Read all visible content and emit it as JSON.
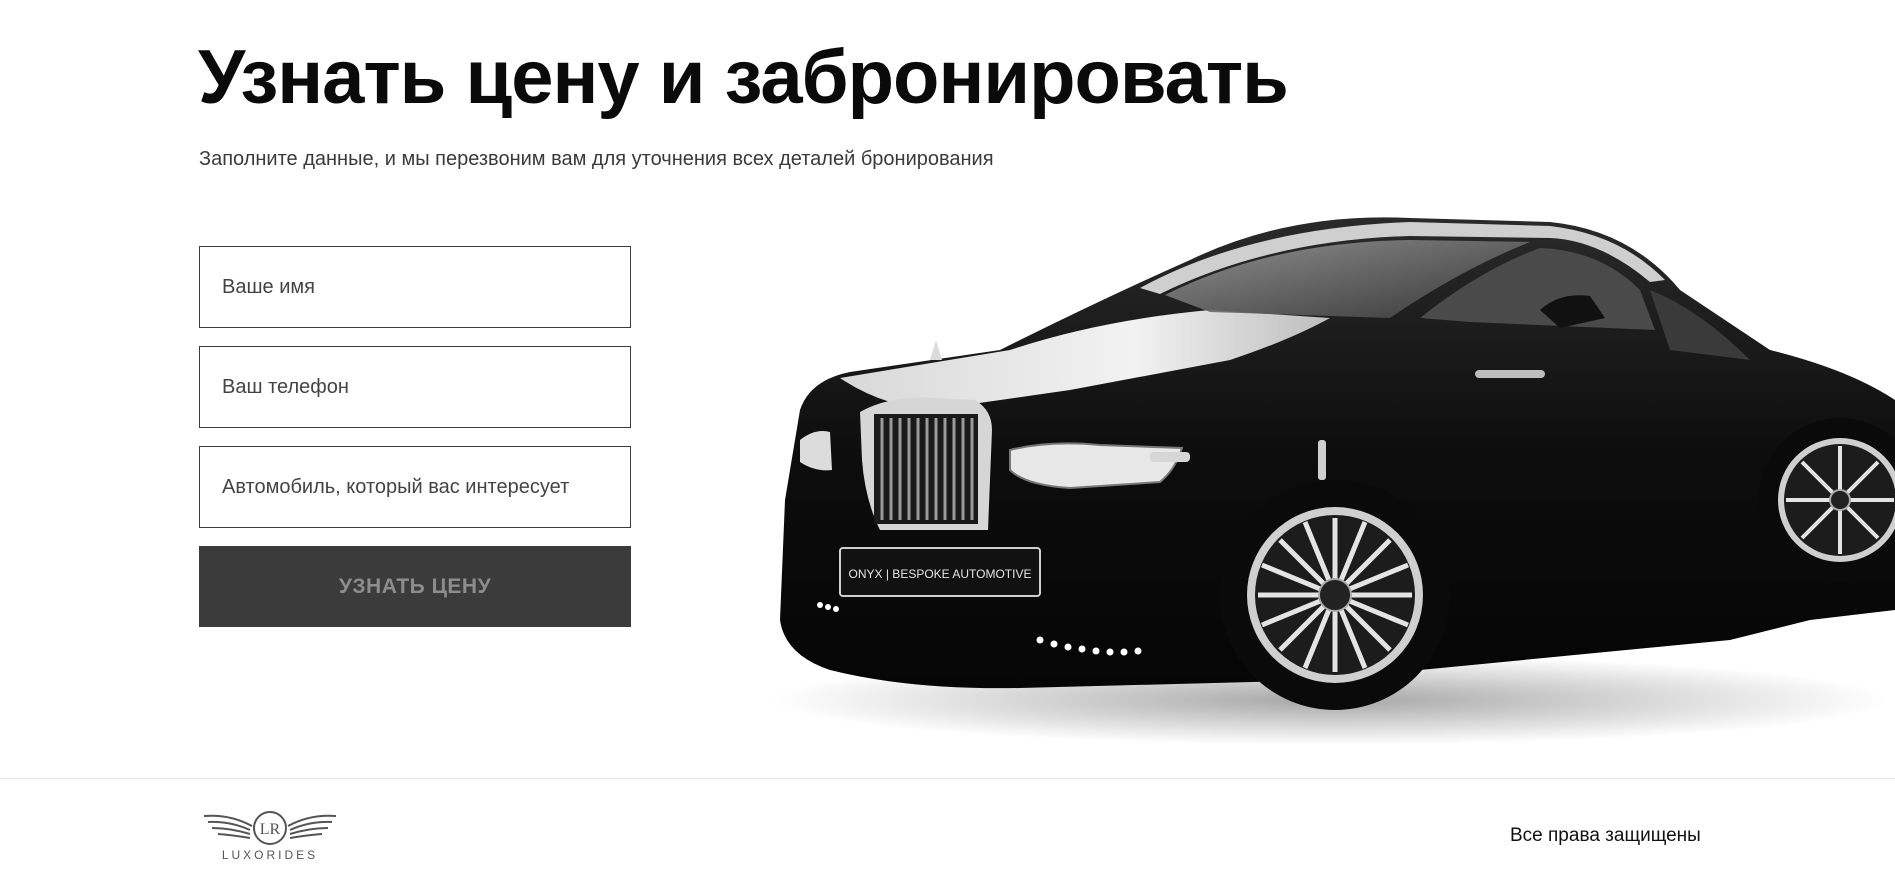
{
  "hero": {
    "title": "Узнать цену и забронировать",
    "subtitle": "Заполните данные, и мы перезвоним вам для уточнения всех деталей бронирования"
  },
  "form": {
    "name_placeholder": "Ваше имя",
    "phone_placeholder": "Ваш телефон",
    "car_placeholder": "Автомобиль, который вас интересует",
    "submit_label": "УЗНАТЬ ЦЕНУ"
  },
  "car_image": {
    "plate_text": "ONYX | BESPOKE AUTOMOTIVE"
  },
  "footer": {
    "logo_text": "LUXORIDES",
    "logo_monogram": "LR",
    "copyright": "Все права защищены"
  },
  "colors": {
    "button_bg": "#3b3b3b",
    "button_text": "#8d8d8d",
    "field_border": "#3c3c3c",
    "title": "#0a0a0a"
  }
}
